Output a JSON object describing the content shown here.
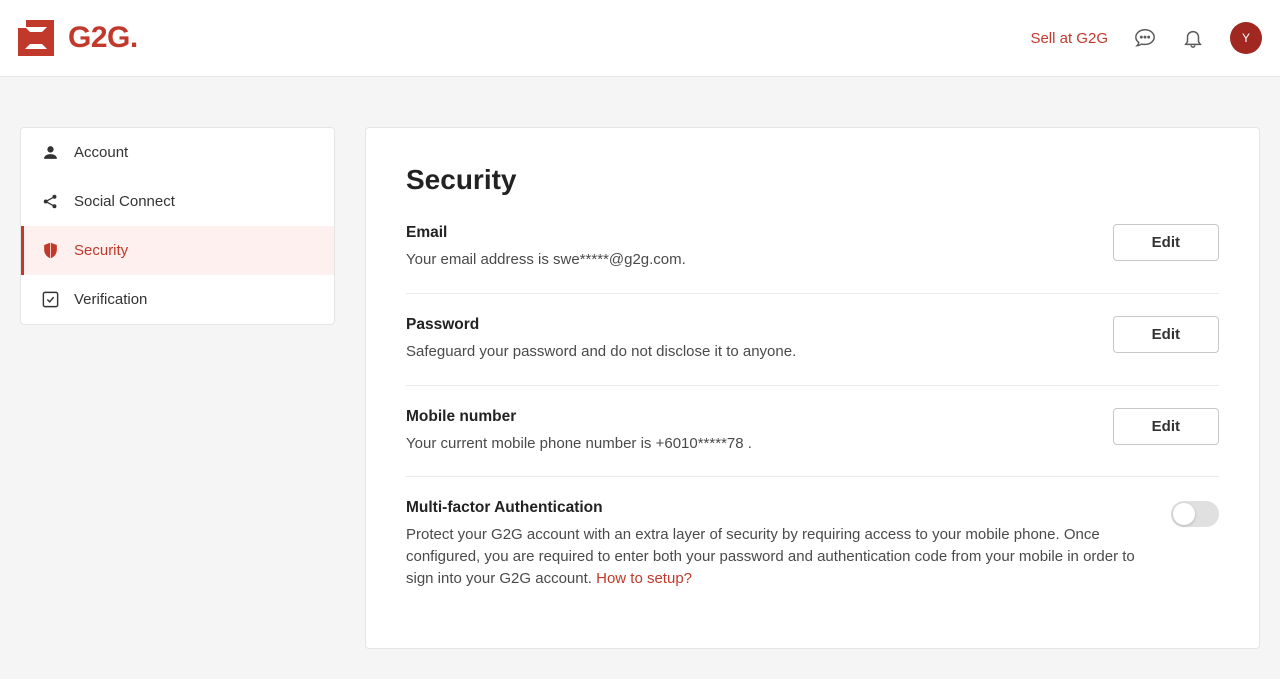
{
  "header": {
    "brand": "G2G",
    "sell_link": "Sell at G2G",
    "avatar_letter": "Y"
  },
  "sidenav": {
    "items": [
      {
        "label": "Account"
      },
      {
        "label": "Social Connect"
      },
      {
        "label": "Security"
      },
      {
        "label": "Verification"
      }
    ]
  },
  "main": {
    "title": "Security",
    "email": {
      "label": "Email",
      "desc": "Your email address is swe*****@g2g.com.",
      "btn": "Edit"
    },
    "password": {
      "label": "Password",
      "desc": "Safeguard your password and do not disclose it to anyone.",
      "btn": "Edit"
    },
    "mobile": {
      "label": "Mobile number",
      "desc": "Your current mobile phone number is +6010*****78 .",
      "btn": "Edit"
    },
    "mfa": {
      "label": "Multi-factor Authentication",
      "desc": "Protect your G2G account with an extra layer of security by requiring access to your mobile phone. Once configured, you are required to enter both your password and authentication code from your mobile in order to sign into your G2G account. ",
      "link": "How to setup?"
    }
  }
}
